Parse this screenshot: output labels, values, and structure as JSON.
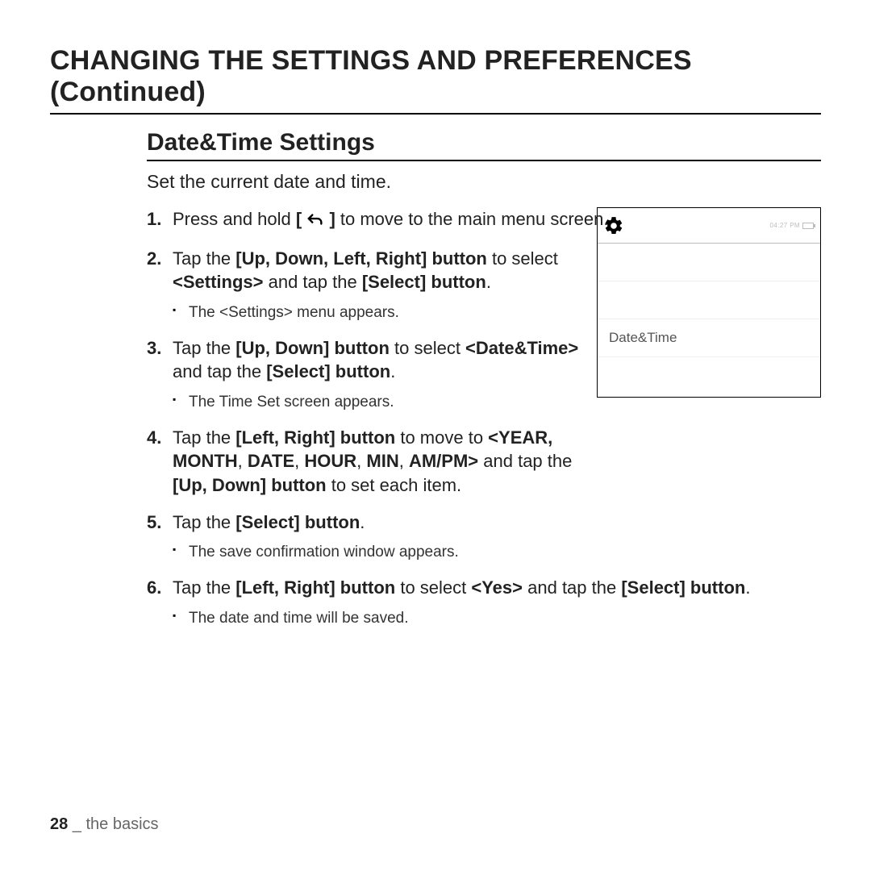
{
  "h1": "CHANGING THE SETTINGS AND PREFERENCES (Continued)",
  "h2": "Date&Time Settings",
  "intro": "Set the current date and time.",
  "steps": {
    "s1_pre": "Press and hold ",
    "s1_key_open": "[ ",
    "s1_key_close": " ]",
    "s1_post": " to move to the main menu screen.",
    "s2_a": "Tap the ",
    "s2_b": "[Up, Down, Left, Right] button",
    "s2_c": " to select ",
    "s2_d": "<Settings>",
    "s2_e": " and tap the ",
    "s2_f": "[Select] button",
    "s2_g": ".",
    "s2_sub": "The <Settings> menu appears.",
    "s3_a": "Tap the ",
    "s3_b": "[Up, Down] button",
    "s3_c": " to select ",
    "s3_d": "<Date&Time>",
    "s3_e": " and tap the ",
    "s3_f": "[Select] button",
    "s3_g": ".",
    "s3_sub": "The Time Set screen appears.",
    "s4_a": "Tap the ",
    "s4_b": "[Left, Right] button",
    "s4_c": " to move to ",
    "s4_d": "<YEAR, MONTH",
    "s4_e": ", ",
    "s4_f": "DATE",
    "s4_g": ", ",
    "s4_h": "HOUR",
    "s4_i": ", ",
    "s4_j": "MIN",
    "s4_k": ", ",
    "s4_l": "AM/PM>",
    "s4_m": " and tap the ",
    "s4_n": "[Up, Down] button",
    "s4_o": " to set each item.",
    "s5_a": "Tap the ",
    "s5_b": "[Select] button",
    "s5_c": ".",
    "s5_sub": "The save conﬁrmation window appears.",
    "s6_a": "Tap the ",
    "s6_b": "[Left, Right] button",
    "s6_c": " to select ",
    "s6_d": "<Yes>",
    "s6_e": " and tap the ",
    "s6_f": "[Select] button",
    "s6_g": ".",
    "s6_sub": "The date and time will be saved."
  },
  "device": {
    "status_time": "04:27 PM",
    "row_label": "Date&Time"
  },
  "footer": {
    "page": "28",
    "sep": " _ ",
    "section": "the basics"
  }
}
